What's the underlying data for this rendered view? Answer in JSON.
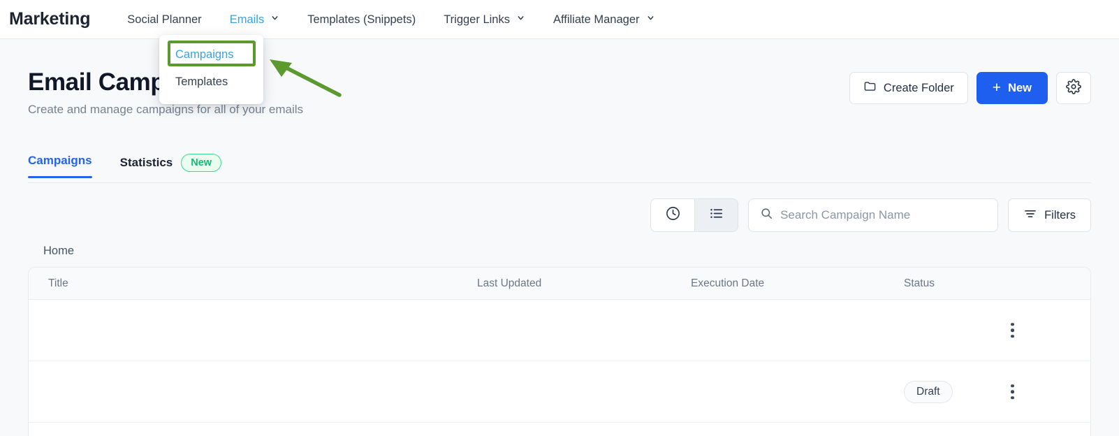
{
  "nav": {
    "brand": "Marketing",
    "items": [
      {
        "label": "Social Planner",
        "has_chevron": false,
        "active": false
      },
      {
        "label": "Emails",
        "has_chevron": true,
        "active": true
      },
      {
        "label": "Templates (Snippets)",
        "has_chevron": false,
        "active": false
      },
      {
        "label": "Trigger Links",
        "has_chevron": true,
        "active": false
      },
      {
        "label": "Affiliate Manager",
        "has_chevron": true,
        "active": false
      }
    ]
  },
  "dropdown": {
    "items": [
      {
        "label": "Campaigns",
        "highlighted": true
      },
      {
        "label": "Templates",
        "highlighted": false
      }
    ],
    "highlight_color": "#5c9a30"
  },
  "annotation": {
    "type": "arrow",
    "color": "#5c9a30",
    "points_to": "Campaigns"
  },
  "header": {
    "title": "Email Campaigns",
    "subtitle": "Create and manage campaigns for all of your emails",
    "create_folder_label": "Create Folder",
    "new_label": "New",
    "new_plus": "+",
    "settings_icon": "gear-icon",
    "accent_blue": "#1f5ff0"
  },
  "tabs": [
    {
      "label": "Campaigns",
      "active": true,
      "badge": ""
    },
    {
      "label": "Statistics",
      "active": false,
      "badge": "New"
    }
  ],
  "toolbar": {
    "view_history_icon": "clock-icon",
    "view_list_icon": "list-icon",
    "search_placeholder": "Search Campaign Name",
    "search_value": "",
    "filters_label": "Filters"
  },
  "breadcrumb": "Home",
  "table": {
    "columns": [
      "Title",
      "Last Updated",
      "Execution Date",
      "Status"
    ],
    "rows": [
      {
        "title": "",
        "last_updated": "",
        "execution_date": "",
        "status": ""
      },
      {
        "title": "",
        "last_updated": "",
        "execution_date": "",
        "status": "Draft"
      }
    ]
  }
}
